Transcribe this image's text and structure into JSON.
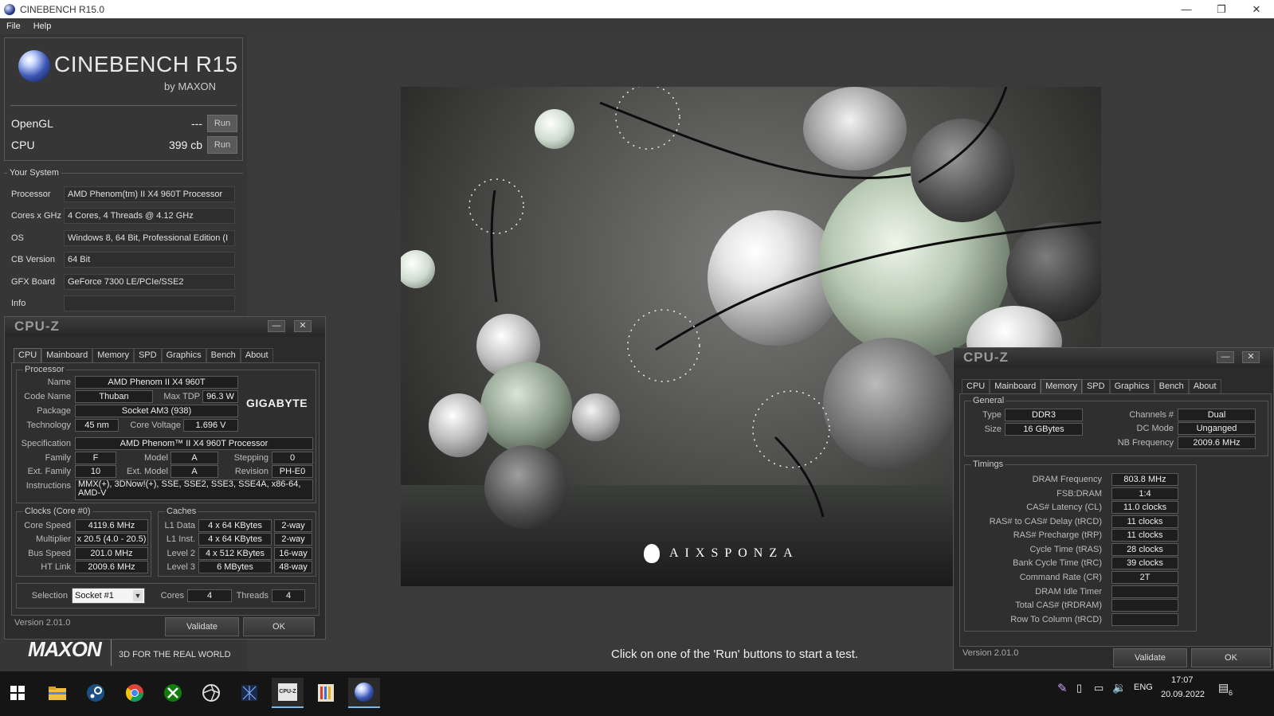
{
  "window": {
    "title": "CINEBENCH R15.0",
    "min": "—",
    "restore": "❐",
    "close": "✕"
  },
  "menu": [
    "File",
    "Help"
  ],
  "logo": {
    "title": "CINEBENCH R15",
    "subtitle": "by MAXON"
  },
  "bench": {
    "opengl": {
      "label": "OpenGL",
      "value": "---",
      "run": "Run"
    },
    "cpu": {
      "label": "CPU",
      "value": "399 cb",
      "run": "Run"
    }
  },
  "system": {
    "legend": "Your System",
    "rows": [
      {
        "k": "Processor",
        "v": "AMD Phenom(tm) II X4 960T Processor"
      },
      {
        "k": "Cores x GHz",
        "v": "4 Cores, 4 Threads @ 4.12 GHz"
      },
      {
        "k": "OS",
        "v": "Windows 8, 64 Bit, Professional Edition (I"
      },
      {
        "k": "CB Version",
        "v": "64 Bit"
      },
      {
        "k": "GFX Board",
        "v": "GeForce 7300 LE/PCIe/SSE2"
      },
      {
        "k": "Info",
        "v": ""
      }
    ]
  },
  "maxon": {
    "logo": "MAXON",
    "tagline": "3D FOR THE REAL WORLD"
  },
  "render": {
    "brand": "AIXSPONZA"
  },
  "status": "Click on one of the 'Run' buttons to start a test.",
  "cpuz_left": {
    "logo": "CPU-Z",
    "min": "—",
    "close": "✕",
    "tabs": [
      "CPU",
      "Mainboard",
      "Memory",
      "SPD",
      "Graphics",
      "Bench",
      "About"
    ],
    "processor": {
      "legend": "Processor",
      "name_l": "Name",
      "name": "AMD Phenom II X4 960T",
      "code_l": "Code Name",
      "code": "Thuban",
      "tdp_l": "Max TDP",
      "tdp": "96.3 W",
      "pkg_l": "Package",
      "pkg": "Socket AM3 (938)",
      "tech_l": "Technology",
      "tech": "45 nm",
      "volt_l": "Core Voltage",
      "volt": "1.696 V",
      "spec_l": "Specification",
      "spec": "AMD Phenom™ II X4 960T Processor",
      "fam_l": "Family",
      "fam": "F",
      "model_l": "Model",
      "model": "A",
      "step_l": "Stepping",
      "step": "0",
      "efam_l": "Ext. Family",
      "efam": "10",
      "emodel_l": "Ext. Model",
      "emodel": "A",
      "rev_l": "Revision",
      "rev": "PH-E0",
      "inst_l": "Instructions",
      "inst": "MMX(+), 3DNow!(+), SSE, SSE2, SSE3, SSE4A, x86-64, AMD-V",
      "brand": "GIGABYTE"
    },
    "clocks": {
      "legend": "Clocks (Core #0)",
      "speed_l": "Core Speed",
      "speed": "4119.6 MHz",
      "mult_l": "Multiplier",
      "mult": "x 20.5 (4.0 - 20.5)",
      "bus_l": "Bus Speed",
      "bus": "201.0 MHz",
      "ht_l": "HT Link",
      "ht": "2009.6 MHz"
    },
    "caches": {
      "legend": "Caches",
      "rows": [
        {
          "k": "L1 Data",
          "size": "4 x 64 KBytes",
          "way": "2-way"
        },
        {
          "k": "L1 Inst.",
          "size": "4 x 64 KBytes",
          "way": "2-way"
        },
        {
          "k": "Level 2",
          "size": "4 x 512 KBytes",
          "way": "16-way"
        },
        {
          "k": "Level 3",
          "size": "6 MBytes",
          "way": "48-way"
        }
      ]
    },
    "selection": {
      "label": "Selection",
      "value": "Socket #1",
      "cores_l": "Cores",
      "cores": "4",
      "threads_l": "Threads",
      "threads": "4"
    },
    "version": "Version 2.01.0",
    "validate": "Validate",
    "ok": "OK"
  },
  "cpuz_right": {
    "logo": "CPU-Z",
    "min": "—",
    "close": "✕",
    "tabs": [
      "CPU",
      "Mainboard",
      "Memory",
      "SPD",
      "Graphics",
      "Bench",
      "About"
    ],
    "general": {
      "legend": "General",
      "type_l": "Type",
      "type": "DDR3",
      "size_l": "Size",
      "size": "16 GBytes",
      "ch_l": "Channels #",
      "ch": "Dual",
      "dc_l": "DC Mode",
      "dc": "Unganged",
      "nb_l": "NB Frequency",
      "nb": "2009.6 MHz"
    },
    "timings": {
      "legend": "Timings",
      "rows": [
        {
          "k": "DRAM Frequency",
          "v": "803.8 MHz"
        },
        {
          "k": "FSB:DRAM",
          "v": "1:4"
        },
        {
          "k": "CAS# Latency (CL)",
          "v": "11.0 clocks"
        },
        {
          "k": "RAS# to CAS# Delay (tRCD)",
          "v": "11 clocks"
        },
        {
          "k": "RAS# Precharge (tRP)",
          "v": "11 clocks"
        },
        {
          "k": "Cycle Time (tRAS)",
          "v": "28 clocks"
        },
        {
          "k": "Bank Cycle Time (tRC)",
          "v": "39 clocks"
        },
        {
          "k": "Command Rate (CR)",
          "v": "2T"
        },
        {
          "k": "DRAM Idle Timer",
          "v": ""
        },
        {
          "k": "Total CAS# (tRDRAM)",
          "v": ""
        },
        {
          "k": "Row To Column (tRCD)",
          "v": ""
        }
      ]
    },
    "version": "Version 2.01.0",
    "validate": "Validate",
    "ok": "OK"
  },
  "taskbar": {
    "lang": "ENG",
    "time": "17:07",
    "date": "20.09.2022",
    "notif_count": "6",
    "cpuz_icon_text": "CPU-Z",
    "colors": {
      "accent": "#76b9ed",
      "chrome_red": "#db4437",
      "chrome_yellow": "#f4c20d",
      "chrome_green": "#0f9d58",
      "xbox": "#107c10"
    }
  }
}
